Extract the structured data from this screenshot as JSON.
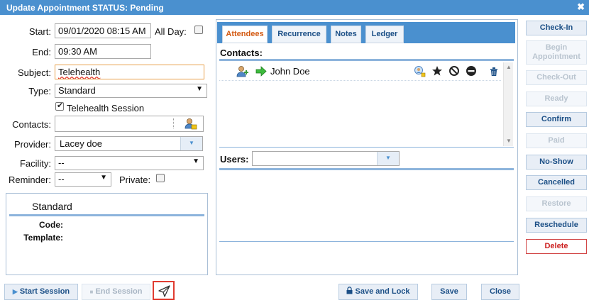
{
  "dialog": {
    "title": "Update Appointment STATUS: Pending",
    "close_glyph": "✖"
  },
  "form": {
    "start_label": "Start:",
    "start_value": "09/01/2020 08:15 AM",
    "allday_label": "All Day:",
    "allday_checked": false,
    "end_label": "End:",
    "end_value": "09:30 AM",
    "subject_label": "Subject:",
    "subject_value": "Telehealth",
    "type_label": "Type:",
    "type_value": "Standard",
    "telehealth_label": "Telehealth Session",
    "telehealth_checked": true,
    "contacts_label": "Contacts:",
    "contacts_value": "",
    "provider_label": "Provider:",
    "provider_value": "Lacey doe",
    "facility_label": "Facility:",
    "facility_value": "--",
    "reminder_label": "Reminder:",
    "reminder_value": "--",
    "private_label": "Private:",
    "private_checked": false
  },
  "type_panel": {
    "heading": "Standard",
    "code_label": "Code:",
    "template_label": "Template:"
  },
  "tabs": [
    {
      "label": "Attendees",
      "active": true
    },
    {
      "label": "Recurrence",
      "active": false
    },
    {
      "label": "Notes",
      "active": false
    },
    {
      "label": "Ledger",
      "active": false
    }
  ],
  "attendees": {
    "contacts_heading": "Contacts:",
    "contact_name": "John Doe",
    "users_label": "Users:",
    "users_value": ""
  },
  "status_buttons": {
    "checkin": "Check-In",
    "begin_line1": "Begin",
    "begin_line2": "Appointment",
    "checkout": "Check-Out",
    "ready": "Ready",
    "confirm": "Confirm",
    "paid": "Paid",
    "noshow": "No-Show",
    "cancelled": "Cancelled",
    "restore": "Restore",
    "reschedule": "Reschedule",
    "delete": "Delete"
  },
  "footer": {
    "start_session": "Start Session",
    "end_session": "End Session",
    "save_and_lock": "Save and Lock",
    "save": "Save",
    "close": "Close"
  },
  "colors": {
    "accent": "#4a90cf",
    "link": "#1b4f86",
    "active_tab": "#d35a12",
    "danger": "#cc1f1f",
    "highlight": "#e03c31"
  }
}
